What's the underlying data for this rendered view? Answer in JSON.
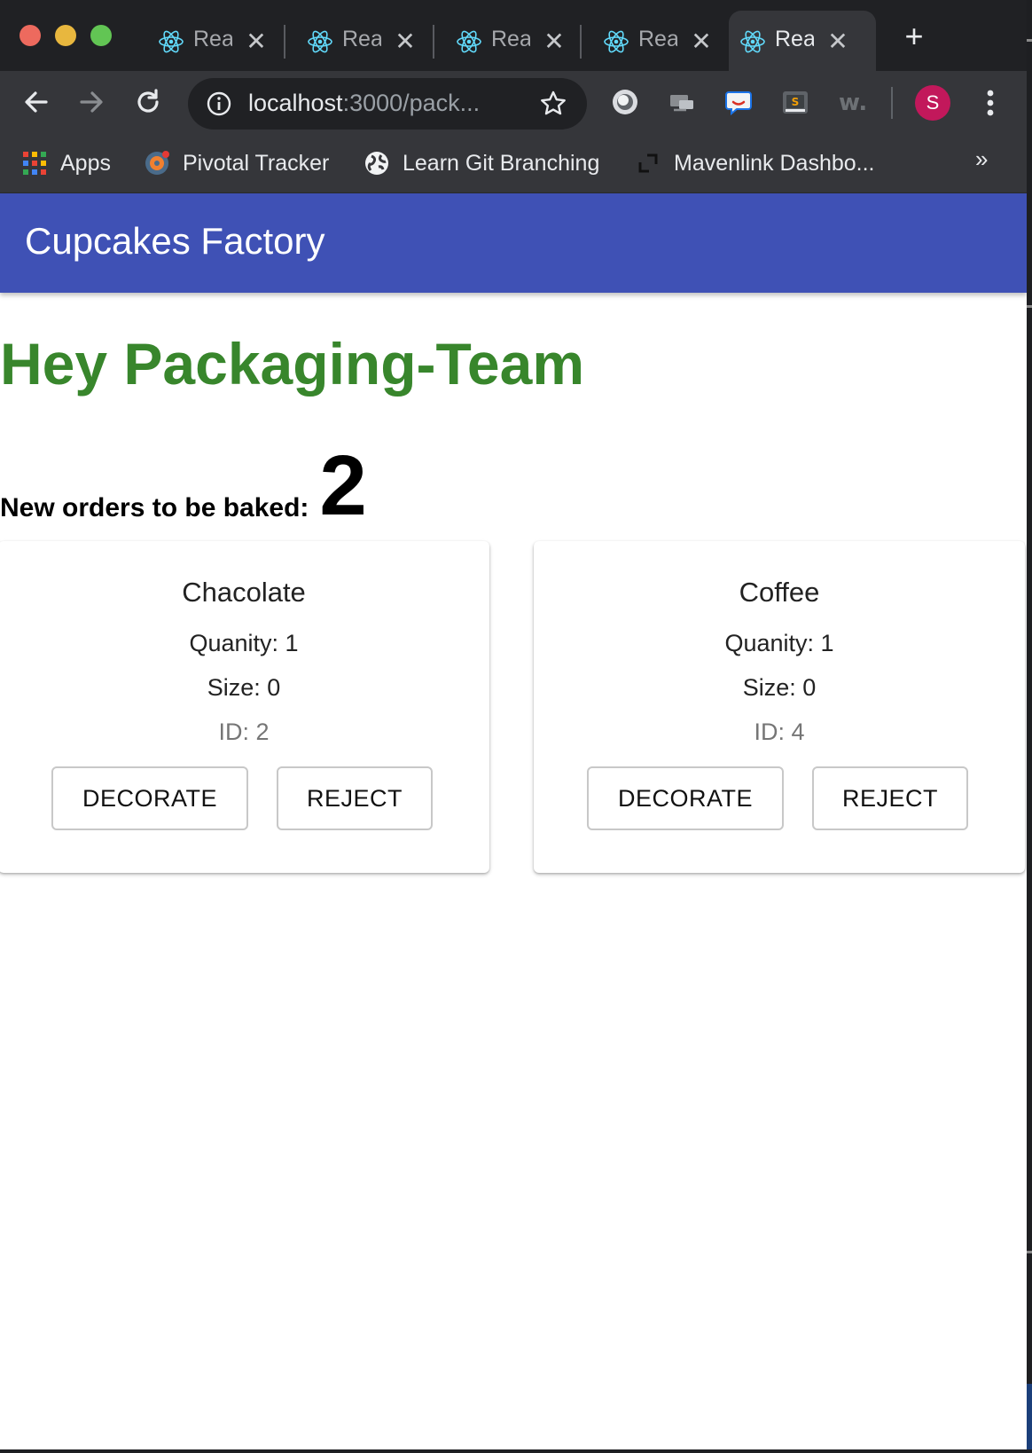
{
  "browser": {
    "tabs": [
      {
        "label": "Rea",
        "close": "✕"
      },
      {
        "label": "Rea",
        "close": "✕"
      },
      {
        "label": "Rea",
        "close": "✕"
      },
      {
        "label": "Rea",
        "close": "✕"
      },
      {
        "label": "Rea",
        "close": "✕",
        "active": true
      }
    ],
    "new_tab": "+",
    "url_host": "localhost",
    "url_path": ":3000/pack...",
    "profile_initial": "S",
    "bookmarks": [
      {
        "label": "Apps",
        "icon": "apps-grid-icon"
      },
      {
        "label": "Pivotal Tracker",
        "icon": "pivotal-tracker-icon"
      },
      {
        "label": "Learn Git Branching",
        "icon": "globe-icon"
      },
      {
        "label": "Mavenlink Dashbo...",
        "icon": "mavenlink-icon"
      }
    ],
    "bookmarks_more": "»",
    "extensions": [
      "screen-recorder-icon",
      "cast-icon",
      "chat-extension-icon",
      "sublime-icon",
      "w-extension-icon"
    ]
  },
  "app": {
    "title": "Cupcakes Factory",
    "greeting": "Hey Packaging-Team",
    "orders_label": "New orders to be baked:",
    "orders_count": "2",
    "colors": {
      "appbar": "#3f51b5",
      "greeting": "#38862c"
    },
    "orders": [
      {
        "flavor": "Chacolate",
        "quantity": "Quanity: 1",
        "size": "Size: 0",
        "id": "ID: 2",
        "decorate": "DECORATE",
        "reject": "REJECT"
      },
      {
        "flavor": "Coffee",
        "quantity": "Quanity: 1",
        "size": "Size: 0",
        "id": "ID: 4",
        "decorate": "DECORATE",
        "reject": "REJECT"
      }
    ]
  }
}
